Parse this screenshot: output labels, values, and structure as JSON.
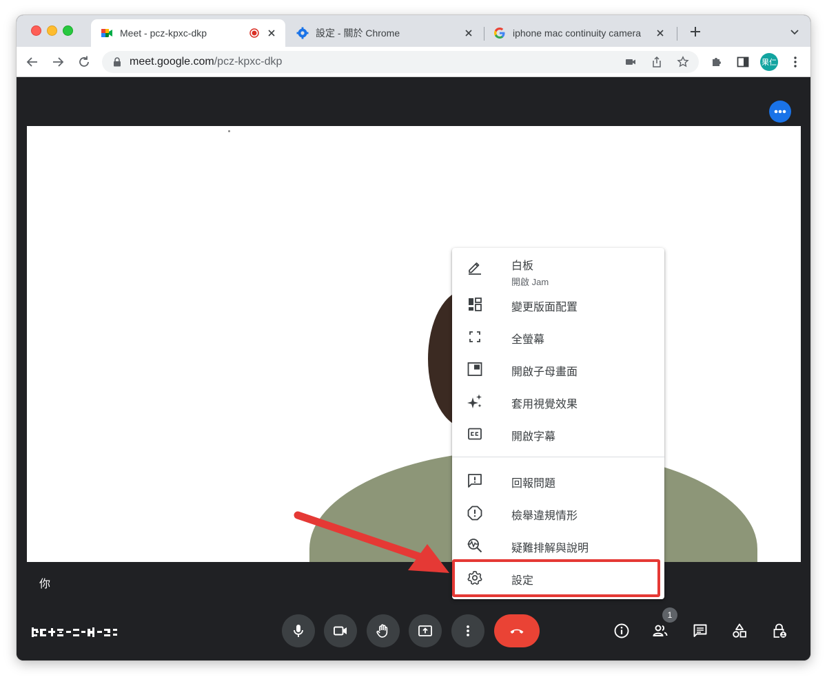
{
  "tabs": [
    {
      "title": "Meet - pcz-kpxc-dkp",
      "active": true
    },
    {
      "title": "設定 - 關於 Chrome",
      "active": false
    },
    {
      "title": "iphone mac continuity camera",
      "active": false
    }
  ],
  "address_bar": {
    "host": "meet.google.com",
    "path": "/pcz-kpxc-dkp"
  },
  "profile": {
    "avatar_text": "果仁"
  },
  "meet": {
    "self_label": "你",
    "participants_count": "1"
  },
  "menu": {
    "items": [
      {
        "label": "白板",
        "sub": "開啟 Jam",
        "icon": "pen-icon"
      },
      {
        "label": "變更版面配置",
        "icon": "layout-icon"
      },
      {
        "label": "全螢幕",
        "icon": "fullscreen-icon"
      },
      {
        "label": "開啟子母畫面",
        "icon": "picture-in-picture-icon"
      },
      {
        "label": "套用視覺效果",
        "icon": "sparkle-icon"
      },
      {
        "label": "開啟字幕",
        "icon": "closed-caption-icon"
      },
      {
        "label": "回報問題",
        "icon": "feedback-icon"
      },
      {
        "label": "檢舉違規情形",
        "icon": "report-icon"
      },
      {
        "label": "疑難排解與說明",
        "icon": "troubleshoot-icon"
      },
      {
        "label": "設定",
        "icon": "gear-icon"
      }
    ]
  },
  "colors": {
    "meet_bg": "#202124",
    "hangup": "#ea4335",
    "accent_blue": "#1a73e8",
    "highlight_red": "#e53935"
  }
}
